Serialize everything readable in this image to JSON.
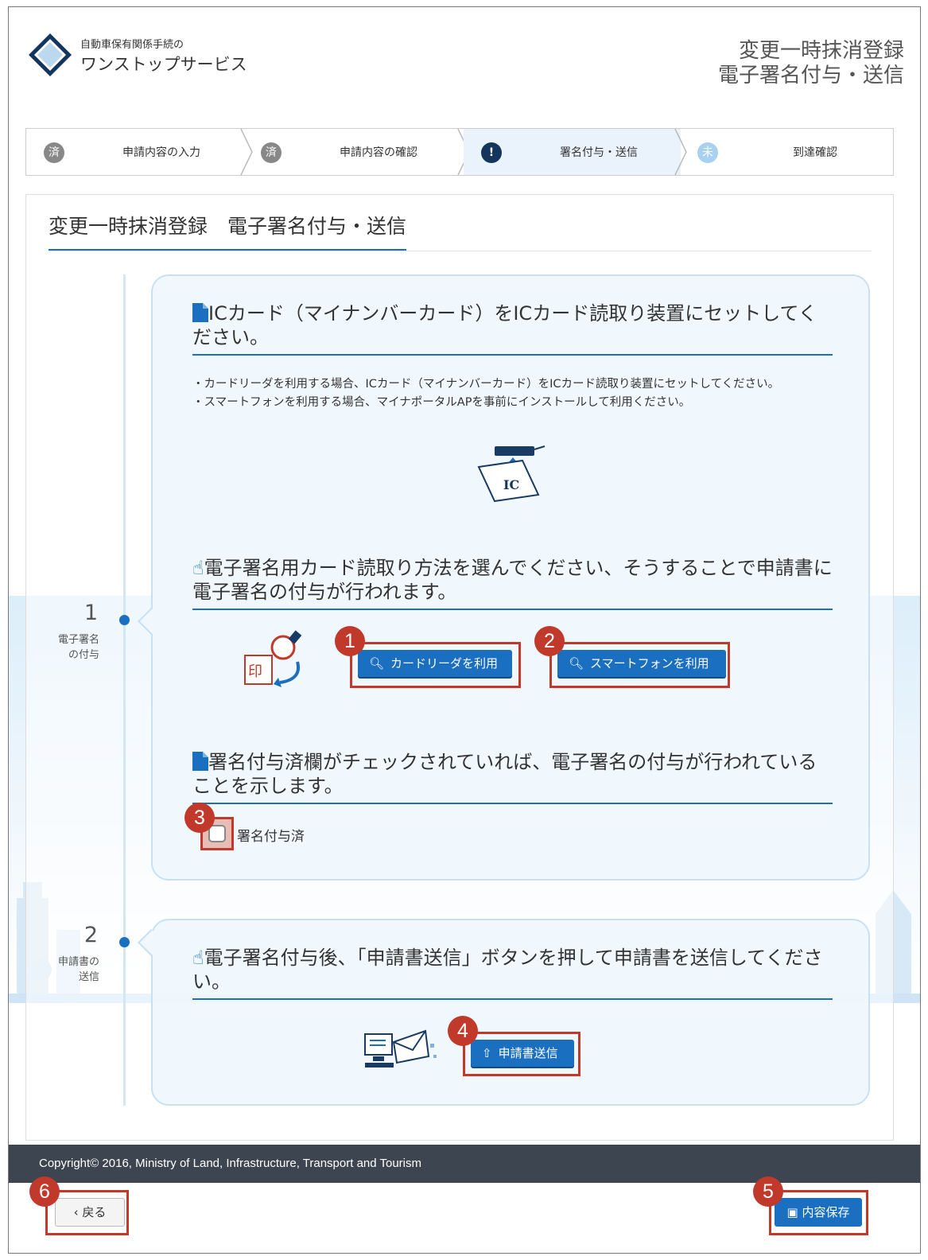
{
  "header": {
    "logo_line1": "自動車保有関係手続の",
    "logo_line2": "ワンストップサービス",
    "title_line1": "変更一時抹消登録",
    "title_line2": "電子署名付与・送信"
  },
  "steps": [
    {
      "icon": "済",
      "label": "申請内容の入力",
      "state": "done"
    },
    {
      "icon": "済",
      "label": "申請内容の確認",
      "state": "done"
    },
    {
      "icon": "!",
      "label": "署名付与・送信",
      "state": "current"
    },
    {
      "icon": "未",
      "label": "到達確認",
      "state": "pending"
    }
  ],
  "page_title": "変更一時抹消登録　電子署名付与・送信",
  "section1": {
    "number": "1",
    "label_line1": "電子署名",
    "label_line2": "の付与",
    "card_heading": "ICカード（マイナンバーカード）をICカード読取り装置にセットしてください。",
    "note_line1": "・カードリーダを利用する場合、ICカード（マイナンバーカード）をICカード読取り装置にセットしてください。",
    "note_line2": "・スマートフォンを利用する場合、マイナポータルAPを事前にインストールして利用ください。",
    "ic_text": "IC",
    "select_heading": "電子署名用カード読取り方法を選んでください、そうすることで申請書に電子署名の付与が行われます。",
    "seal_text": "印",
    "card_reader_button": "カードリーダを利用",
    "smartphone_button": "スマートフォンを利用",
    "check_heading": "署名付与済欄がチェックされていれば、電子署名の付与が行われていることを示します。",
    "checkbox_label": "署名付与済"
  },
  "section2": {
    "number": "2",
    "label_line1": "申請書の",
    "label_line2": "送信",
    "heading": "電子署名付与後、「申請書送信」ボタンを押して申請書を送信してください。",
    "send_button": "申請書送信"
  },
  "footer": {
    "copyright": "Copyright© 2016, Ministry of Land, Infrastructure, Transport and Tourism"
  },
  "back_button": "戻る",
  "save_button": "内容保存",
  "badges": [
    "1",
    "2",
    "3",
    "4",
    "5",
    "6"
  ],
  "colors": {
    "accent": "#1a6fc0",
    "highlight": "#c0392b",
    "footer": "#3d4550"
  }
}
